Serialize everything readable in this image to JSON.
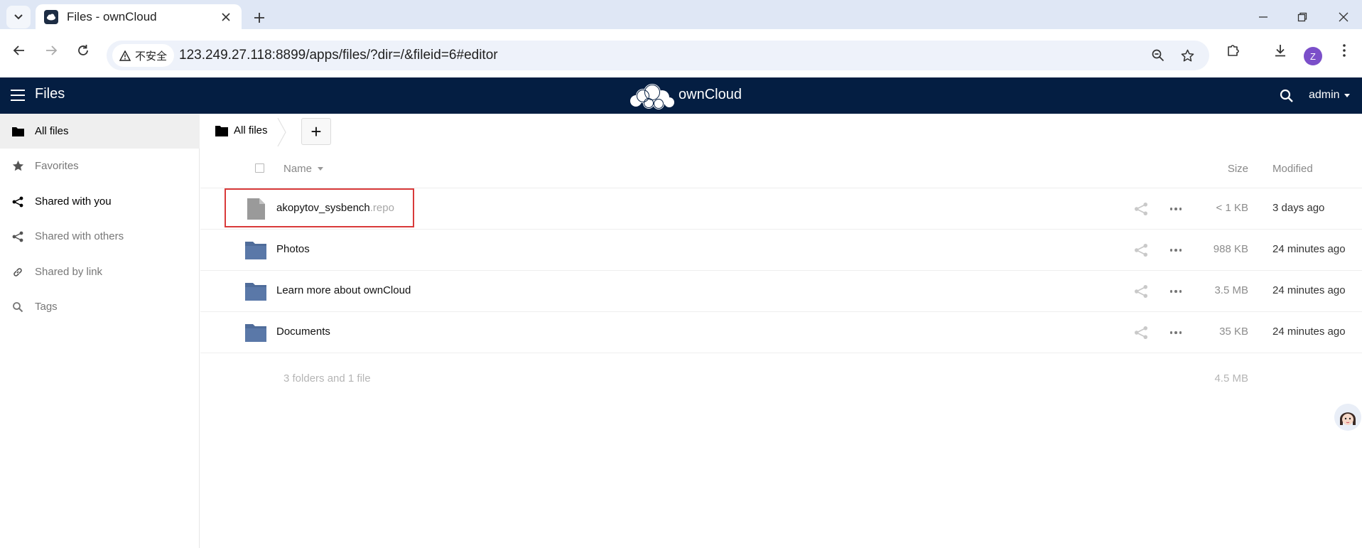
{
  "browser": {
    "tab_title": "Files - ownCloud",
    "security_label": "不安全",
    "url": "123.249.27.118:8899/apps/files/?dir=/&fileid=6#editor",
    "profile_initial": "Z"
  },
  "header": {
    "app_name": "Files",
    "logo_text": "ownCloud",
    "user": "admin",
    "bg_color": "#041e42"
  },
  "sidebar": {
    "items": [
      {
        "label": "All files",
        "icon": "folder-icon",
        "active": true
      },
      {
        "label": "Favorites",
        "icon": "star-icon"
      },
      {
        "label": "Shared with you",
        "icon": "share-icon"
      },
      {
        "label": "Shared with others",
        "icon": "share-icon"
      },
      {
        "label": "Shared by link",
        "icon": "link-icon"
      },
      {
        "label": "Tags",
        "icon": "search-icon"
      }
    ]
  },
  "breadcrumb": {
    "label": "All files",
    "add_button": "+"
  },
  "table": {
    "columns": {
      "name": "Name",
      "size": "Size",
      "modified": "Modified"
    },
    "rows": [
      {
        "name": "akopytov_sysbench",
        "ext": ".repo",
        "type": "file",
        "size": "< 1 KB",
        "modified": "3 days ago"
      },
      {
        "name": "Photos",
        "ext": "",
        "type": "folder",
        "size": "988 KB",
        "modified": "24 minutes ago"
      },
      {
        "name": "Learn more about ownCloud",
        "ext": "",
        "type": "folder",
        "size": "3.5 MB",
        "modified": "24 minutes ago"
      },
      {
        "name": "Documents",
        "ext": "",
        "type": "folder",
        "size": "35 KB",
        "modified": "24 minutes ago"
      }
    ],
    "summary": {
      "text": "3 folders and 1 file",
      "size": "4.5 MB"
    }
  },
  "colors": {
    "folder": "#4f6c9a",
    "file": "#9a9a9a",
    "highlight": "#d93a3a"
  }
}
